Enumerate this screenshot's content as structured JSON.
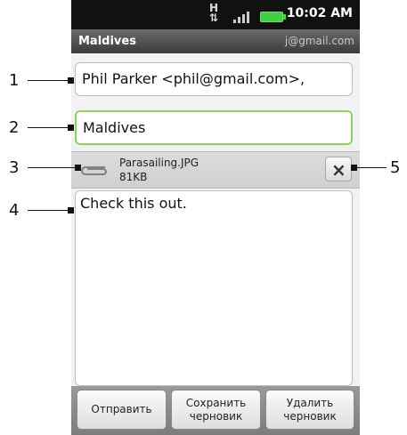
{
  "status_bar": {
    "time": "10:02 AM",
    "h_indicator": "H"
  },
  "title_bar": {
    "subject": "Maldives",
    "account": "j@gmail.com"
  },
  "to_field": {
    "value": "Phil Parker <phil@gmail.com>,"
  },
  "subject_field": {
    "value": "Maldives"
  },
  "attachment": {
    "filename": "Parasailing.JPG",
    "size": "81KB",
    "remove_symbol": "×"
  },
  "body_field": {
    "value": "Check this out."
  },
  "bottom_bar": {
    "send_label": "Отправить",
    "save_draft_label": "Сохранить черновик",
    "delete_draft_label": "Удалить черновик"
  },
  "callouts": [
    "1",
    "2",
    "3",
    "4",
    "5"
  ],
  "icons": {
    "signal": "signal-icon",
    "battery": "battery-icon",
    "data": "data-indicator-icon",
    "paperclip": "paperclip-icon",
    "close": "close-icon"
  },
  "colors": {
    "subject_focus_border": "#8dd45a",
    "battery": "#3fd13f"
  }
}
